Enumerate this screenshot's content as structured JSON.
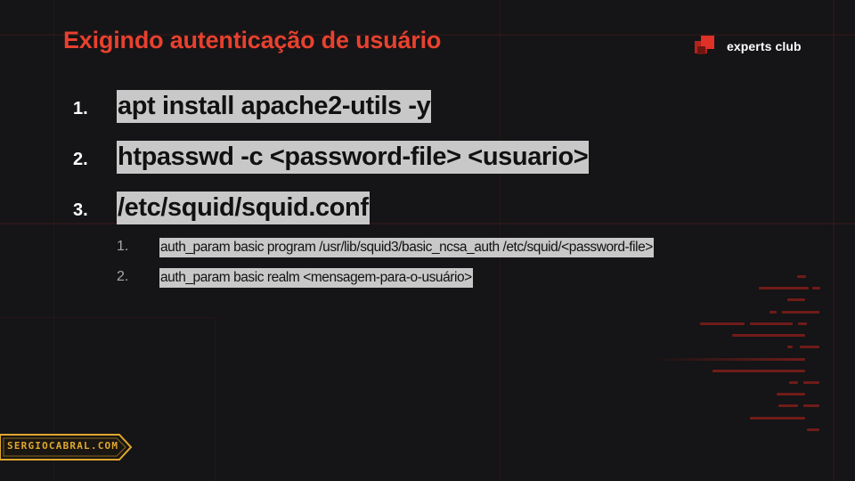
{
  "slide": {
    "title": "Exigindo autenticação de usuário",
    "logo_text": "experts club",
    "steps": [
      {
        "number": "1.",
        "command": "apt install apache2-utils -y"
      },
      {
        "number": "2.",
        "command": "htpasswd -c <password-file> <usuario>"
      },
      {
        "number": "3.",
        "command": "/etc/squid/squid.conf"
      }
    ],
    "sub_steps": [
      {
        "number": "1.",
        "command": "auth_param basic program /usr/lib/squid3/basic_ncsa_auth /etc/squid/<password-file>"
      },
      {
        "number": "2.",
        "command": "auth_param basic realm <mensagem-para-o-usuário>"
      }
    ],
    "badge_text": "SERGIOCABRAL.COM"
  },
  "colors": {
    "background": "#151416",
    "title": "#e8412f",
    "highlight": "#c8c8c8",
    "badge": "#e0a72f",
    "decor": "#6f1c19"
  },
  "icons": {
    "logo": "experts-club-logo-icon",
    "badge_frame": "badge-frame-icon"
  }
}
